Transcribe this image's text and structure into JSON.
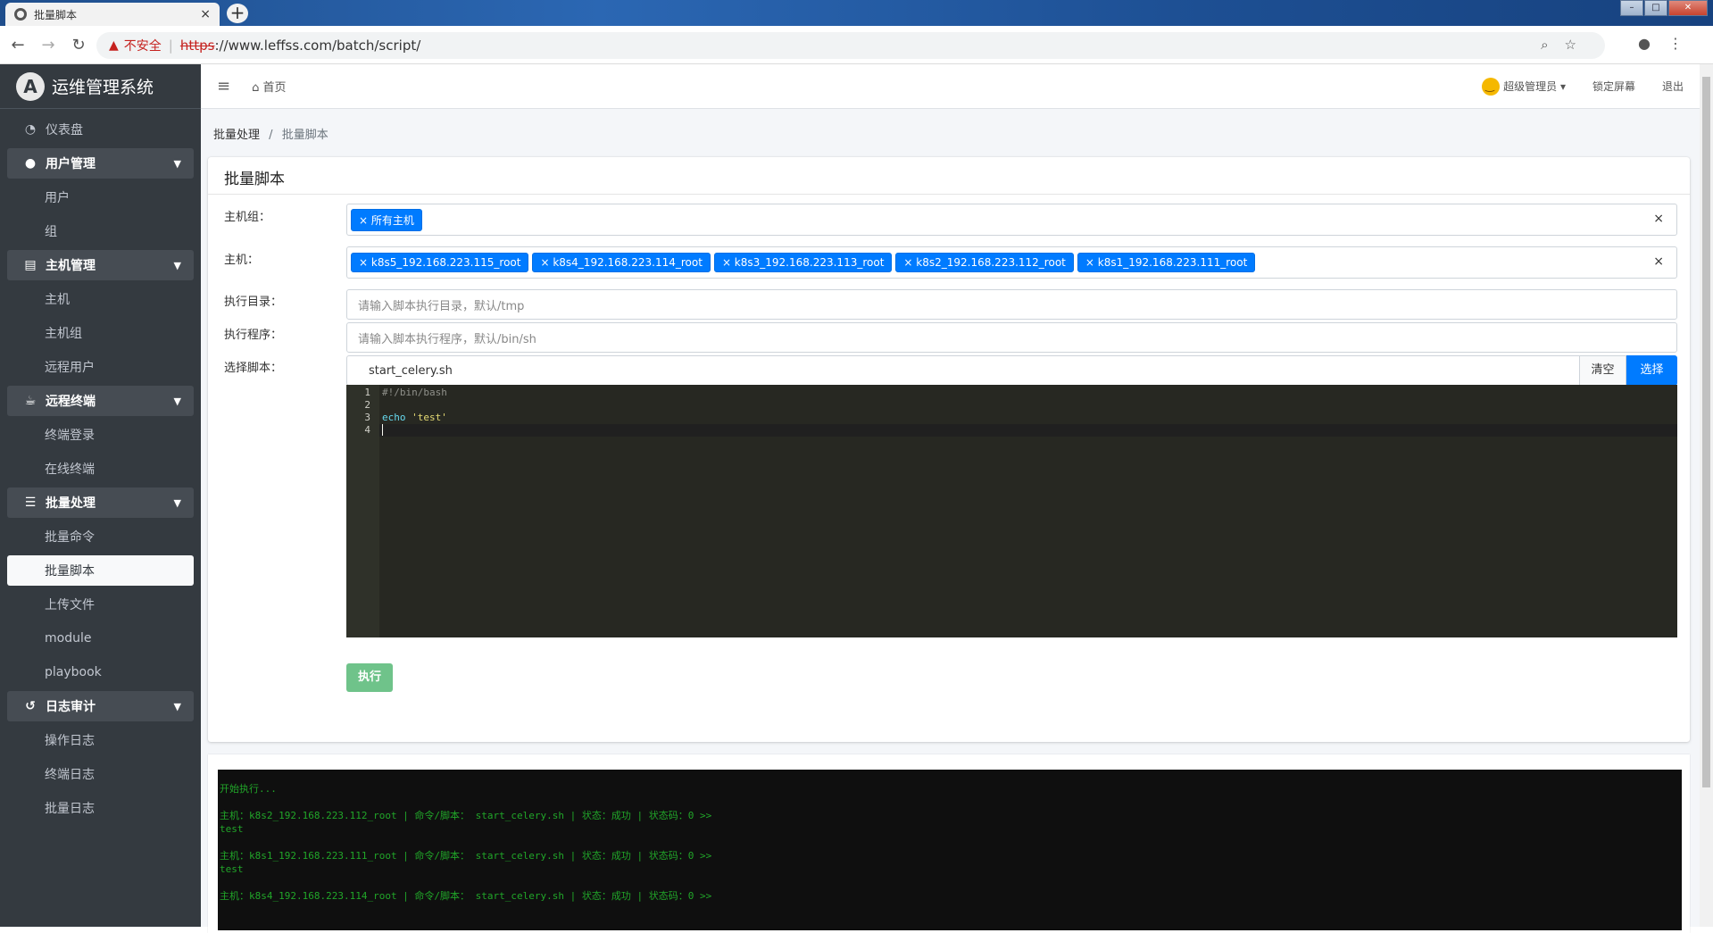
{
  "browser": {
    "tab_title": "批量脚本",
    "tab_close": "×",
    "new_tab": "+",
    "insecure_label": "不安全",
    "url_scheme": "https",
    "url_rest": "://www.leffss.com/batch/script/"
  },
  "sidebar": {
    "brand": "运维管理系统",
    "brand_logo": "A",
    "items": [
      {
        "label": "仪表盘",
        "icon": "dashboard-icon",
        "type": "item"
      },
      {
        "label": "用户管理",
        "icon": "user-icon",
        "type": "group"
      },
      {
        "label": "用户",
        "type": "sub"
      },
      {
        "label": "组",
        "type": "sub"
      },
      {
        "label": "主机管理",
        "icon": "copy-icon",
        "type": "group"
      },
      {
        "label": "主机",
        "type": "sub"
      },
      {
        "label": "主机组",
        "type": "sub"
      },
      {
        "label": "远程用户",
        "type": "sub"
      },
      {
        "label": "远程终端",
        "icon": "coffee-icon",
        "type": "group"
      },
      {
        "label": "终端登录",
        "type": "sub"
      },
      {
        "label": "在线终端",
        "type": "sub"
      },
      {
        "label": "批量处理",
        "icon": "list-icon",
        "type": "group"
      },
      {
        "label": "批量命令",
        "type": "sub"
      },
      {
        "label": "批量脚本",
        "type": "sub-active"
      },
      {
        "label": "上传文件",
        "type": "sub"
      },
      {
        "label": "module",
        "type": "sub"
      },
      {
        "label": "playbook",
        "type": "sub"
      },
      {
        "label": "日志审计",
        "icon": "history-icon",
        "type": "group"
      },
      {
        "label": "操作日志",
        "type": "sub"
      },
      {
        "label": "终端日志",
        "type": "sub"
      },
      {
        "label": "批量日志",
        "type": "sub"
      }
    ]
  },
  "topnav": {
    "home": "首页",
    "user": "超级管理员",
    "lock": "锁定屏幕",
    "logout": "退出"
  },
  "breadcrumb": {
    "parent": "批量处理",
    "separator": "/",
    "current": "批量脚本"
  },
  "form": {
    "title": "批量脚本",
    "host_group_label": "主机组：",
    "host_groups": [
      "× 所有主机"
    ],
    "host_label": "主机：",
    "hosts": [
      "× k8s5_192.168.223.115_root",
      "× k8s4_192.168.223.114_root",
      "× k8s3_192.168.223.113_root",
      "× k8s2_192.168.223.112_root",
      "× k8s1_192.168.223.111_root"
    ],
    "clear_x": "×",
    "dir_label": "执行目录：",
    "dir_placeholder": "请输入脚本执行目录，默认/tmp",
    "prog_label": "执行程序：",
    "prog_placeholder": "请输入脚本执行程序，默认/bin/sh",
    "script_label": "选择脚本：",
    "script_value": "start_celery.sh",
    "clear_button": "清空",
    "select_button": "选择",
    "exec_button": "执行"
  },
  "editor": {
    "line_numbers": [
      "1",
      "2",
      "3",
      "4"
    ],
    "line1": "#!/bin/bash",
    "line3_kw": "echo",
    "line3_str": "'test'"
  },
  "terminal": {
    "lines": [
      "开始执行...",
      "",
      "主机：k8s2_192.168.223.112_root | 命令/脚本： start_celery.sh | 状态：成功 | 状态码：0 >>",
      "test",
      "",
      "主机：k8s1_192.168.223.111_root | 命令/脚本： start_celery.sh | 状态：成功 | 状态码：0 >>",
      "test",
      "",
      "主机：k8s4_192.168.223.114_root | 命令/脚本： start_celery.sh | 状态：成功 | 状态码：0 >>"
    ]
  },
  "colors": {
    "sidebar_bg": "#343a40",
    "primary": "#007bff",
    "success_button": "#6fc38a",
    "terminal_text": "#21a629"
  }
}
